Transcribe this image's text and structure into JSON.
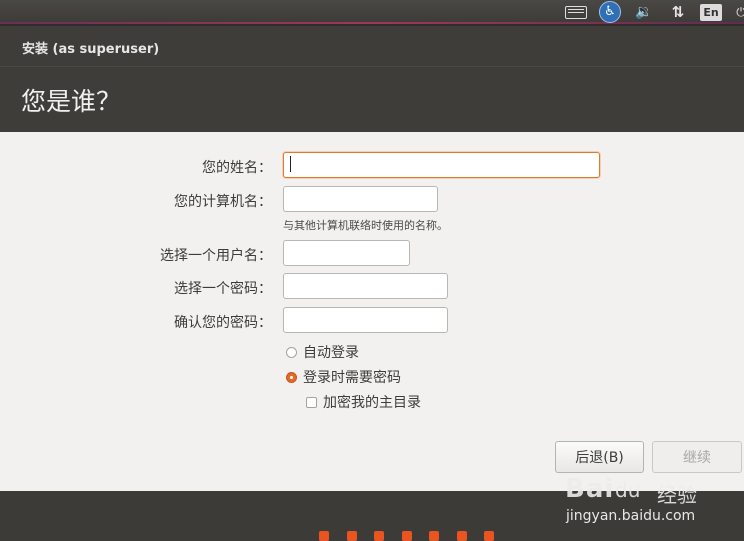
{
  "panel": {
    "keyboard_icon": "keyboard-icon",
    "accessibility_icon": "accessibility-icon",
    "accessibility_glyph": "♿",
    "volume_glyph": "🔉",
    "network_glyph": "⇅",
    "language": "En",
    "power_glyph": "⏻"
  },
  "window": {
    "title": "安装 (as superuser)",
    "heading": "您是谁？"
  },
  "form": {
    "name_label": "您的姓名：",
    "name_value": "",
    "computer_label": "您的计算机名：",
    "computer_value": "",
    "computer_hint": "与其他计算机联络时使用的名称。",
    "username_label": "选择一个用户名：",
    "username_value": "",
    "password_label": "选择一个密码：",
    "password_value": "",
    "confirm_label": "确认您的密码：",
    "confirm_value": ""
  },
  "options": {
    "auto_login": {
      "label": "自动登录",
      "checked": false
    },
    "require_password": {
      "label": "登录时需要密码",
      "checked": true
    },
    "encrypt_home": {
      "label": "加密我的主目录",
      "checked": false
    }
  },
  "buttons": {
    "back": "后退(B)",
    "continue": "继续"
  },
  "progress": {
    "steps": 7
  },
  "watermark": {
    "logo": "Bai",
    "paw": "du",
    "brand_cn": "经验",
    "url": "jingyan.baidu.com"
  },
  "colors": {
    "accent": "#e95420",
    "focus_border": "#e2792d"
  }
}
